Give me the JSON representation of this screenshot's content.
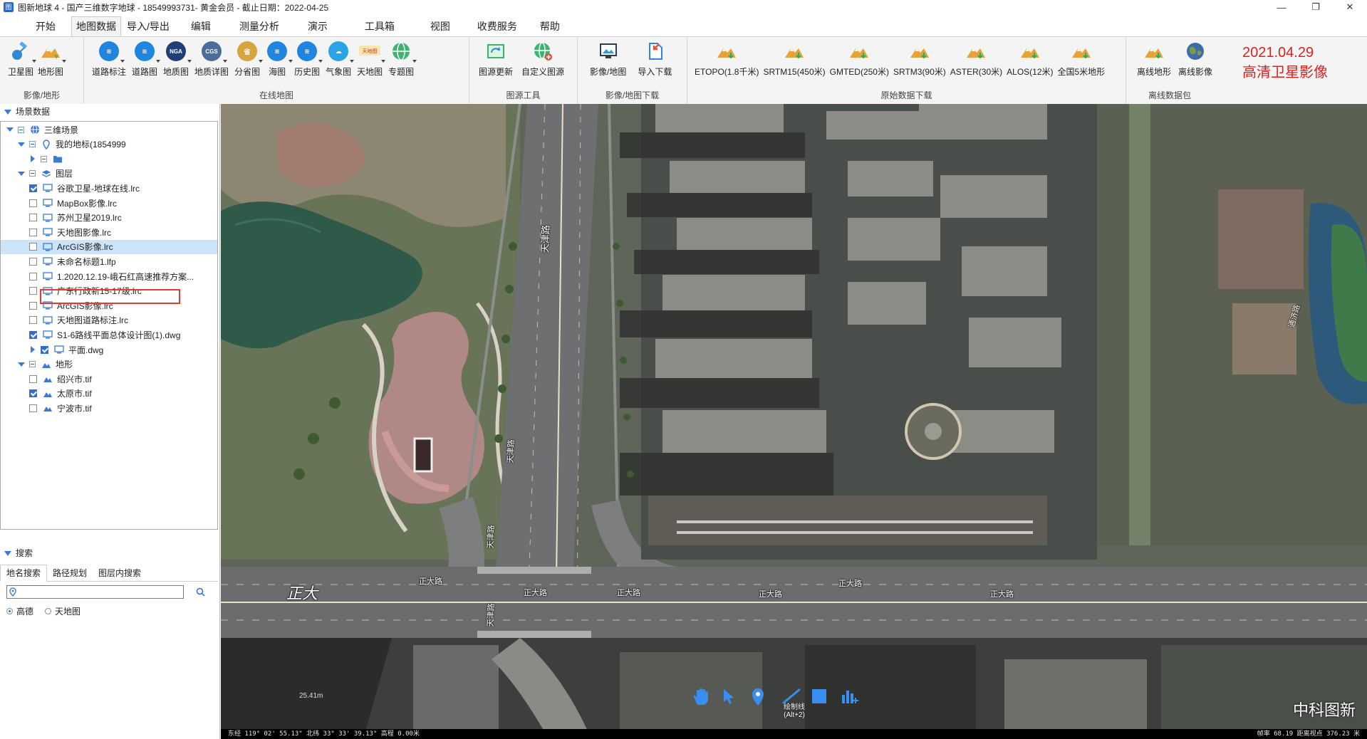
{
  "window": {
    "title": "图新地球 4 - 国产三维数字地球 - 18549993731- 黄金会员 - 截止日期：2022-04-25",
    "min": "—",
    "max": "❐",
    "close": "✕"
  },
  "menu": [
    "开始",
    "地图数据",
    "导入/导出",
    "编辑",
    "测量分析",
    "演示",
    "工具箱",
    "视图",
    "收费服务",
    "帮助"
  ],
  "ribbon": {
    "groups": [
      {
        "name": "影像/地形",
        "buttons": [
          {
            "label": "卫星图",
            "icon": "satellite-icon"
          },
          {
            "label": "地形图",
            "icon": "terrain-icon"
          }
        ]
      },
      {
        "name": "在线地图",
        "buttons": [
          {
            "label": "道路标注",
            "icon": "layers-icon"
          },
          {
            "label": "道路图",
            "icon": "layers-icon"
          },
          {
            "label": "地质图",
            "icon": "nga-icon",
            "text": "NGA"
          },
          {
            "label": "地质详图",
            "icon": "cgs-icon",
            "text": "CGS"
          },
          {
            "label": "分省图",
            "icon": "province-icon"
          },
          {
            "label": "海图",
            "icon": "layers-icon"
          },
          {
            "label": "历史图",
            "icon": "layers-icon"
          },
          {
            "label": "气象图",
            "icon": "cloud-icon"
          },
          {
            "label": "天地图",
            "icon": "tianditu-icon"
          },
          {
            "label": "专题图",
            "icon": "globe-icon"
          }
        ]
      },
      {
        "name": "图源工具",
        "buttons": [
          {
            "label": "图源更新",
            "icon": "map-refresh-icon"
          },
          {
            "label": "自定义图源",
            "icon": "globe-plus-icon"
          }
        ]
      },
      {
        "name": "影像/地图下载",
        "buttons": [
          {
            "label": "影像/地图",
            "icon": "image-download-icon"
          },
          {
            "label": "导入下载",
            "icon": "import-download-icon"
          }
        ]
      },
      {
        "name": "原始数据下载",
        "buttons": [
          {
            "label": "ETOPO(1.8千米)",
            "icon": "terrain-icon"
          },
          {
            "label": "SRTM15(450米)",
            "icon": "terrain-icon"
          },
          {
            "label": "GMTED(250米)",
            "icon": "terrain-icon"
          },
          {
            "label": "SRTM3(90米)",
            "icon": "terrain-icon"
          },
          {
            "label": "ASTER(30米)",
            "icon": "terrain-icon"
          },
          {
            "label": "ALOS(12米)",
            "icon": "terrain-icon"
          },
          {
            "label": "全国5米地形",
            "icon": "terrain-icon"
          }
        ]
      },
      {
        "name": "离线数据包",
        "buttons": [
          {
            "label": "离线地形",
            "icon": "terrain-icon"
          },
          {
            "label": "离线影像",
            "icon": "earth-icon"
          }
        ]
      }
    ],
    "badge": [
      "2021.04.29",
      "高清卫星影像"
    ]
  },
  "left_panel": {
    "scene_header": "场景数据",
    "tree": [
      {
        "level": 0,
        "exp": "down",
        "label": "三维场景",
        "icon": "globe-icon",
        "minus": true
      },
      {
        "level": 1,
        "exp": "down",
        "label": "我的地标(1854999",
        "icon": "pin-icon",
        "minus": true
      },
      {
        "level": 2,
        "exp": "right",
        "label": "",
        "icon": "folder-icon",
        "minus": true
      },
      {
        "level": 1,
        "exp": "down",
        "label": "图层",
        "icon": "layers-icon",
        "minus": true
      },
      {
        "level": 2,
        "check": true,
        "label": "谷歌卫星-地球在线.lrc",
        "icon": "monitor-icon"
      },
      {
        "level": 2,
        "check": false,
        "label": "MapBox影像.lrc",
        "icon": "monitor-icon"
      },
      {
        "level": 2,
        "check": false,
        "label": "苏州卫星2019.lrc",
        "icon": "monitor-icon"
      },
      {
        "level": 2,
        "check": false,
        "label": "天地图影像.lrc",
        "icon": "monitor-icon"
      },
      {
        "level": 2,
        "check": false,
        "label": "ArcGIS影像.lrc",
        "icon": "monitor-icon",
        "selected": true
      },
      {
        "level": 2,
        "check": false,
        "label": "未命名标题1.lfp",
        "icon": "monitor-icon"
      },
      {
        "level": 2,
        "check": false,
        "label": "1.2020.12.19-峨石红高速推荐方案...",
        "icon": "monitor-icon"
      },
      {
        "level": 2,
        "check": false,
        "label": "广东行政新15-17级.lrc",
        "icon": "monitor-icon"
      },
      {
        "level": 2,
        "check": false,
        "label": "ArcGIS影像.lrc",
        "icon": "monitor-icon"
      },
      {
        "level": 2,
        "check": false,
        "label": "天地图道路标注.lrc",
        "icon": "monitor-icon"
      },
      {
        "level": 2,
        "check": true,
        "label": "S1-6路线平面总体设计图(1).dwg",
        "icon": "monitor-icon"
      },
      {
        "level": 2,
        "check": true,
        "exp": "right",
        "label": "平面.dwg",
        "icon": "monitor-icon"
      },
      {
        "level": 1,
        "exp": "down",
        "label": "地形",
        "icon": "terrain-small-icon",
        "minus": true
      },
      {
        "level": 2,
        "check": false,
        "label": "绍兴市.tif",
        "icon": "terrain-small-icon"
      },
      {
        "level": 2,
        "check": true,
        "label": "太原市.tif",
        "icon": "terrain-small-icon"
      },
      {
        "level": 2,
        "check": false,
        "label": "宁波市.tif",
        "icon": "terrain-small-icon"
      }
    ],
    "search_header": "搜索",
    "tabs": [
      "地名搜索",
      "路径规划",
      "图层内搜索"
    ],
    "search_placeholder": "",
    "radios": [
      {
        "label": "高德",
        "on": true
      },
      {
        "label": "天地图",
        "on": false
      }
    ]
  },
  "map": {
    "road_labels": [
      "天津路",
      "天津路",
      "天津路",
      "天津路",
      "正大路",
      "正大路",
      "正大路",
      "正大路",
      "正大路",
      "正大路",
      "通济路"
    ],
    "big_label": "正大",
    "tools": [
      {
        "name": "pan-icon"
      },
      {
        "name": "select-arrow-icon"
      },
      {
        "name": "placemark-icon"
      },
      {
        "name": "draw-line-icon",
        "label": "绘制线",
        "sub": "(Alt+2)"
      },
      {
        "name": "draw-polygon-icon"
      },
      {
        "name": "chart-icon"
      }
    ],
    "watermark": "中科图新",
    "status_left": "东经 119° 02' 55.13\"  北纬 33° 33' 39.13\"  高程 0.00米",
    "status_right": "帧率 68.19  距离视点 376.23 米",
    "status_mid": "25.41m"
  }
}
